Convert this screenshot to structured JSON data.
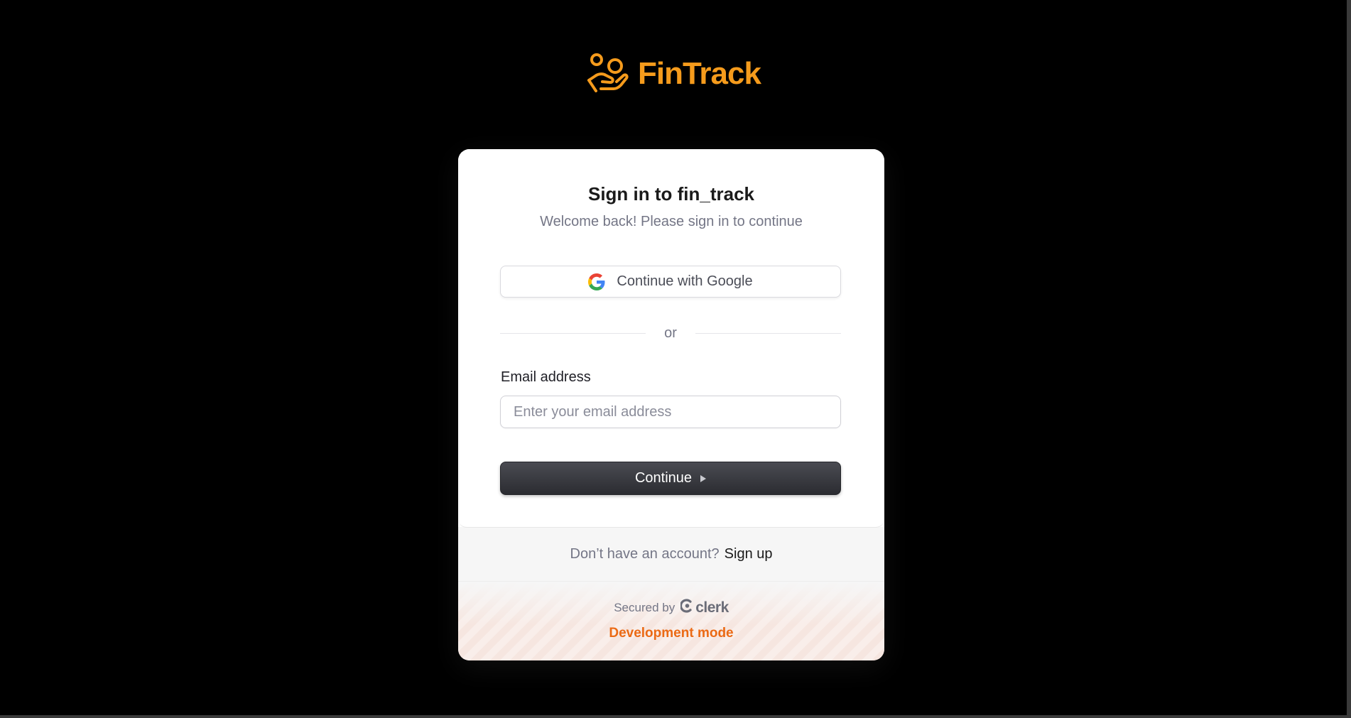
{
  "brand": {
    "name": "FinTrack",
    "color": "#f59b1c",
    "icon": "hand-coin-icon"
  },
  "signin": {
    "title": "Sign in to fin_track",
    "subtitle": "Welcome back! Please sign in to continue",
    "google_button": "Continue with Google",
    "google_icon": "google-icon",
    "divider_text": "or",
    "email_label": "Email address",
    "email_placeholder": "Enter your email address",
    "email_value": "",
    "continue_button": "Continue",
    "continue_icon": "caret-right-icon"
  },
  "footer": {
    "signup_prompt": "Don’t have an account?",
    "signup_link": "Sign up",
    "secured_by": "Secured by",
    "provider": "clerk",
    "provider_icon": "clerk-logo-icon",
    "dev_mode": "Development mode",
    "dev_mode_color": "#eb6a15"
  }
}
